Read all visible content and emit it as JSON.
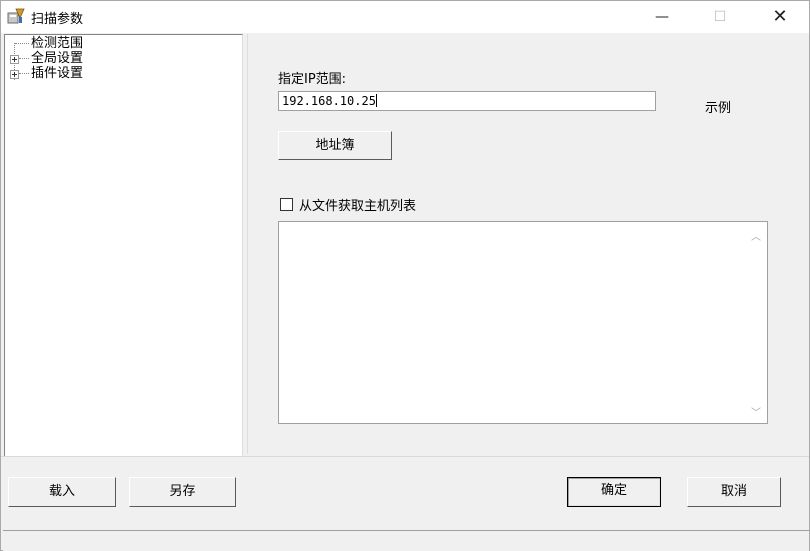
{
  "window": {
    "title": "扫描参数",
    "minimize_glyph": "—",
    "maximize_glyph": "☐",
    "close_glyph": "✕"
  },
  "tree": {
    "items": [
      {
        "label": "检测范围",
        "expandable": false
      },
      {
        "label": "全局设置",
        "expandable": true
      },
      {
        "label": "插件设置",
        "expandable": true
      }
    ]
  },
  "range_panel": {
    "ip_label": "指定IP范围:",
    "ip_value": "192.168.10.25",
    "example_label": "示例",
    "address_book_button": "地址簿",
    "file_hosts_checkbox_label": "从文件获取主机列表",
    "file_hosts_checked": false
  },
  "footer": {
    "load_button": "载入",
    "save_as_button": "另存",
    "ok_button": "确定",
    "cancel_button": "取消"
  },
  "icons": {
    "app": "scan-app-icon",
    "scroll_up": "chevron-up-icon",
    "scroll_down": "chevron-down-icon"
  }
}
